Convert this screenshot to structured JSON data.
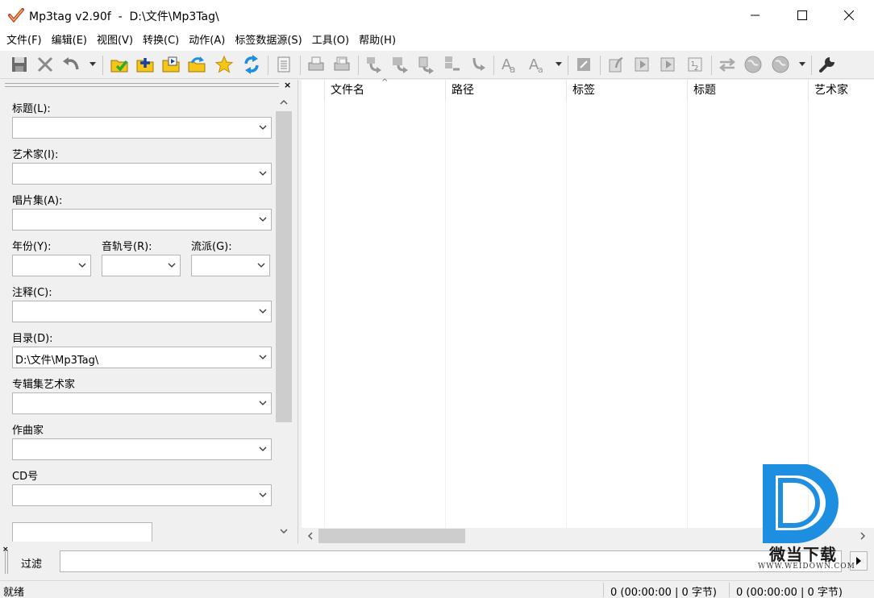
{
  "window": {
    "title": "Mp3tag v2.90f  -  D:\\文件\\Mp3Tag\\"
  },
  "menu": [
    "文件(F)",
    "编辑(E)",
    "视图(V)",
    "转换(C)",
    "动作(A)",
    "标签数据源(S)",
    "工具(O)",
    "帮助(H)"
  ],
  "toolbar": {
    "icons": [
      "save-icon",
      "remove-tag-icon",
      "undo-icon",
      "change-directory-icon",
      "add-directory-icon",
      "open-folder-icon",
      "refresh-folder-icon",
      "favorite-star-icon",
      "reload-icon",
      "extended-tags-icon",
      "export-icon",
      "playlist-icon",
      "tag-to-filename-icon",
      "filename-to-tag-icon",
      "text-file-to-tag-icon",
      "tag-to-tag-icon",
      "filename-to-filename-icon",
      "case-conversion-icon",
      "text-replace-icon",
      "edit-icon",
      "autonumber-icon",
      "import-icon",
      "export-list-icon",
      "numbering-icon",
      "freedb-icon",
      "web-source-icon",
      "web-source-dropdown-icon",
      "options-wrench-icon"
    ]
  },
  "tag_panel": {
    "fields": [
      {
        "label": "标题(L):",
        "value": ""
      },
      {
        "label": "艺术家(I):",
        "value": ""
      },
      {
        "label": "唱片集(A):",
        "value": ""
      },
      {
        "label": "注释(C):",
        "value": ""
      },
      {
        "label": "目录(D):",
        "value": "D:\\文件\\Mp3Tag\\"
      },
      {
        "label": "专辑集艺术家",
        "value": ""
      },
      {
        "label": "作曲家",
        "value": ""
      },
      {
        "label": "CD号",
        "value": ""
      }
    ],
    "small_fields": [
      {
        "label": "年份(Y):",
        "value": ""
      },
      {
        "label": "音轨号(R):",
        "value": ""
      },
      {
        "label": "流派(G):",
        "value": ""
      }
    ],
    "close_glyph": "×"
  },
  "file_list": {
    "columns": [
      "文件名",
      "路径",
      "标签",
      "标题",
      "艺术家"
    ],
    "sort_indicator": "^"
  },
  "filter": {
    "label": "过滤",
    "value": ""
  },
  "status": {
    "text": "就绪",
    "selected": "0 (00:00:00 | 0 字节)",
    "total": "0 (00:00:00 | 0 字节)"
  },
  "watermark": {
    "text": "微当下载",
    "url": "WWW.WEIDOWN.COM"
  },
  "colors": {
    "accent_blue": "#1e8fe0",
    "folder_yellow": "#f5c518",
    "check_green": "#2eaa2e"
  }
}
